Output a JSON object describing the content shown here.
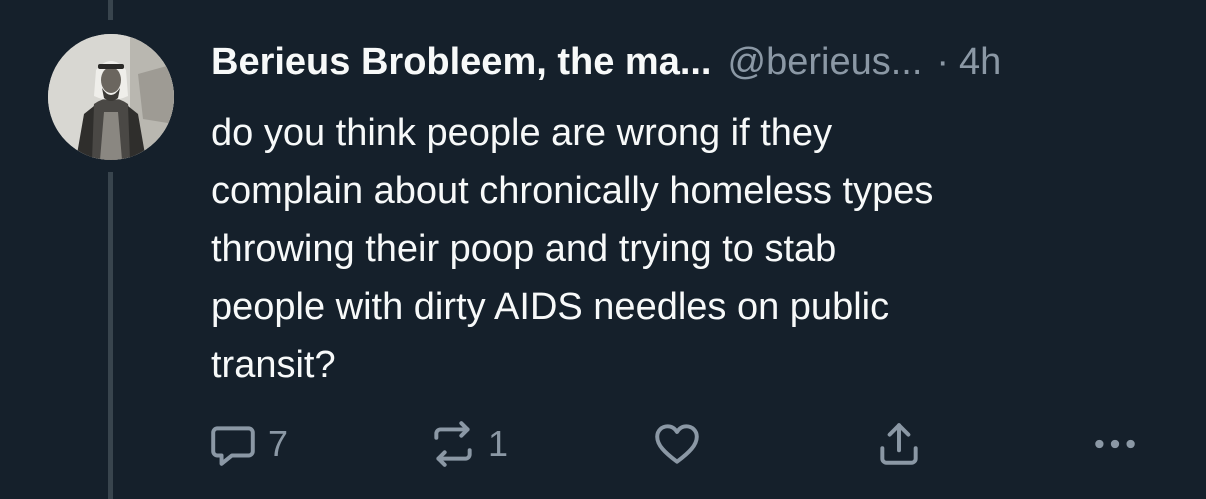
{
  "tweet": {
    "display_name": "Berieus Brobleem, the ma...",
    "handle": "@berieus...",
    "separator": "·",
    "time": "4h",
    "text_lines": [
      "do you think people are wrong if they",
      "complain about chronically homeless types",
      "throwing their poop and trying to stab",
      "people with dirty AIDS needles on public",
      "transit?"
    ]
  },
  "actions": {
    "reply": {
      "icon": "reply-icon",
      "count": "7"
    },
    "retweet": {
      "icon": "retweet-icon",
      "count": "1"
    },
    "like": {
      "icon": "heart-icon",
      "count": ""
    },
    "share": {
      "icon": "share-icon"
    },
    "more": {
      "icon": "more-icon"
    }
  },
  "colors": {
    "background": "#15202b",
    "primary_text": "#f7f9f9",
    "secondary_text": "#8b98a5",
    "thread_line": "#38444d"
  }
}
